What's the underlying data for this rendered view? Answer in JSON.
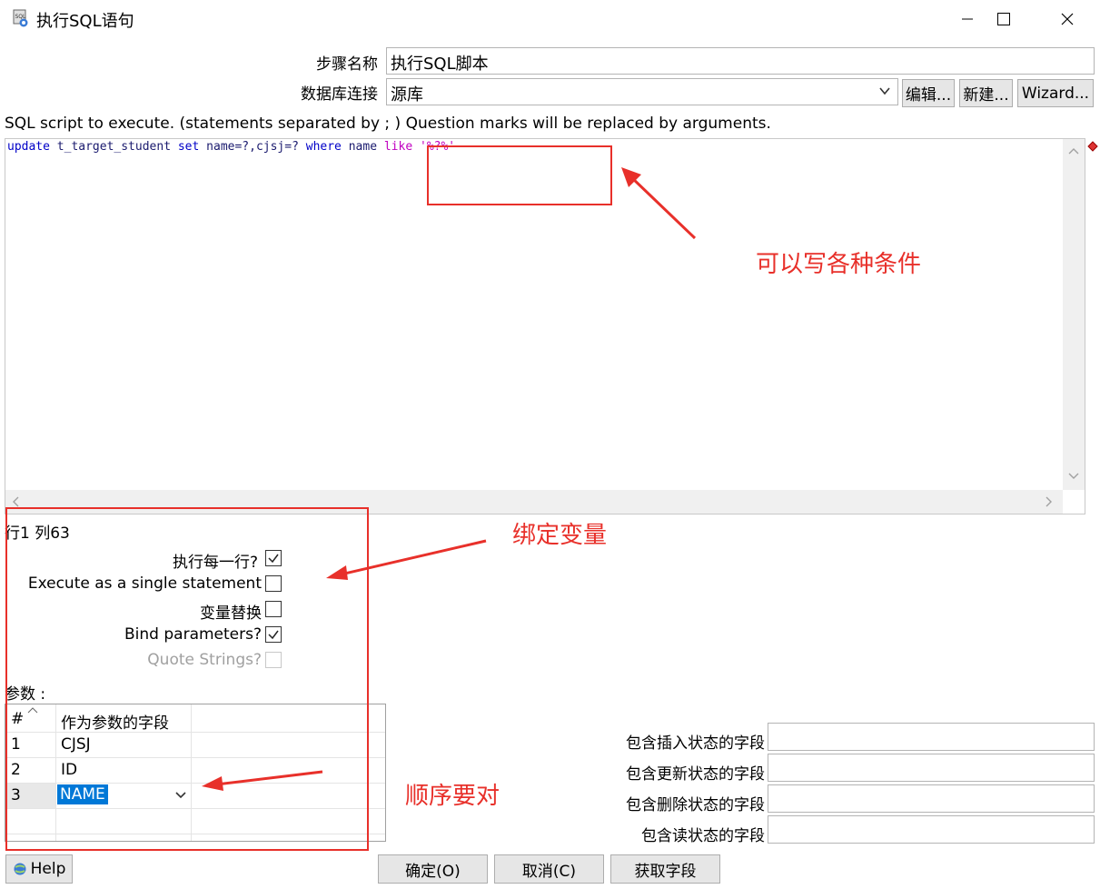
{
  "window": {
    "title": "执行SQL语句",
    "minimize_icon": "minimize-icon",
    "maximize_icon": "maximize-icon",
    "close_icon": "close-icon"
  },
  "form": {
    "step_name_label": "步骤名称",
    "step_name_value": "执行SQL脚本",
    "db_conn_label": "数据库连接",
    "db_conn_value": "源库",
    "edit_button": "编辑...",
    "new_button": "新建...",
    "wizard_button": "Wizard..."
  },
  "sql": {
    "description": "SQL script to execute. (statements separated by ; ) Question marks will be replaced by arguments.",
    "tokens": [
      {
        "t": "update",
        "c": "kw"
      },
      {
        "t": " t_target_student ",
        "c": "plain"
      },
      {
        "t": "set",
        "c": "kw"
      },
      {
        "t": " name=?,cjsj=? ",
        "c": "plain"
      },
      {
        "t": "where",
        "c": "kw"
      },
      {
        "t": " name ",
        "c": "plain"
      },
      {
        "t": "like",
        "c": "str"
      },
      {
        "t": " '%?%'",
        "c": "str"
      }
    ],
    "cursor_position": "行1 列63"
  },
  "options": {
    "execute_each_row": {
      "label": "执行每一行?",
      "checked": true
    },
    "single_statement": {
      "label": "Execute as a single statement",
      "checked": false
    },
    "variable_substitution": {
      "label": "变量替换",
      "checked": false
    },
    "bind_parameters": {
      "label": "Bind parameters?",
      "checked": true
    },
    "quote_strings": {
      "label": "Quote Strings?",
      "checked": false,
      "disabled": true
    }
  },
  "params": {
    "label": "参数 :",
    "headers": [
      "#",
      "作为参数的字段"
    ],
    "rows": [
      {
        "num": "1",
        "field": "CJSJ"
      },
      {
        "num": "2",
        "field": "ID"
      },
      {
        "num": "3",
        "field": "NAME"
      }
    ]
  },
  "status_fields": {
    "insert_label": "包含插入状态的字段",
    "update_label": "包含更新状态的字段",
    "delete_label": "包含删除状态的字段",
    "read_label": "包含读状态的字段",
    "insert_value": "",
    "update_value": "",
    "delete_value": "",
    "read_value": ""
  },
  "footer": {
    "help": "Help",
    "ok": "确定(O)",
    "cancel": "取消(C)",
    "get_fields": "获取字段"
  },
  "annotations": {
    "conditions": "可以写各种条件",
    "bind_vars": "绑定变量",
    "order": "顺序要对"
  },
  "colors": {
    "annotation_red": "#e8302a",
    "keyword_blue": "#0000c8",
    "string_magenta": "#c000c0",
    "selection_blue": "#0078d7"
  }
}
